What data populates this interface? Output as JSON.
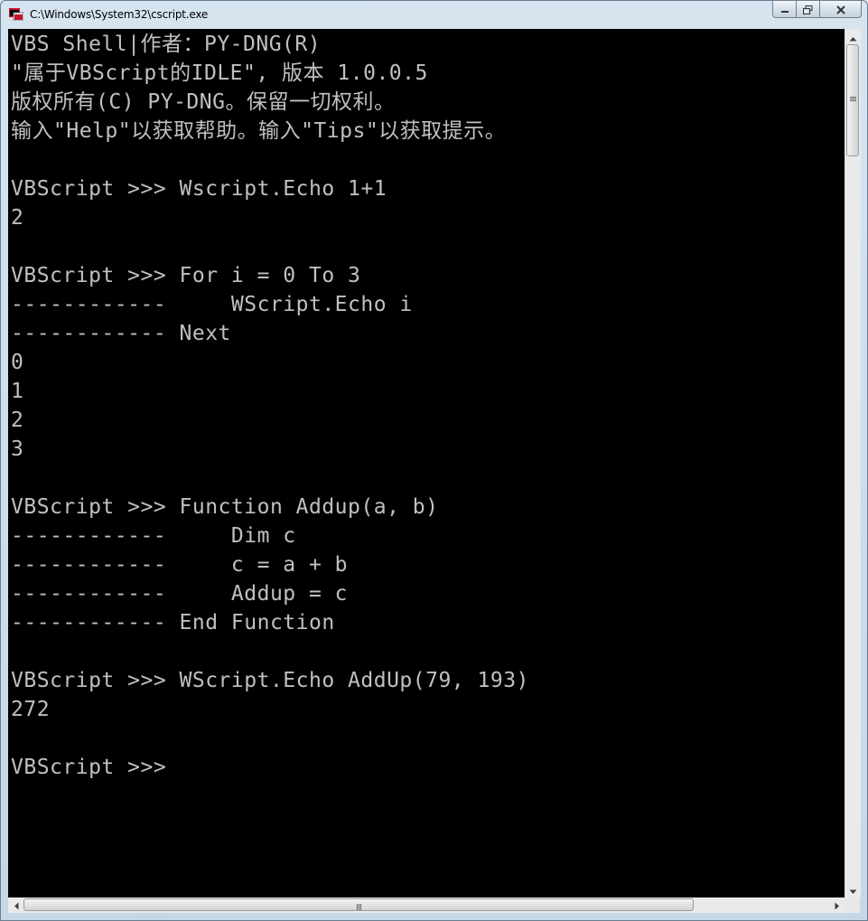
{
  "window": {
    "title": "C:\\Windows\\System32\\cscript.exe",
    "icon": "console-app-icon",
    "buttons": {
      "minimize": "minimize-icon",
      "maximize": "maximize-icon",
      "close": "close-icon"
    }
  },
  "console": {
    "background": "#000000",
    "foreground": "#c0c0c0",
    "lines": [
      "VBS Shell|作者：PY-DNG(R)",
      "\"属于VBScript的IDLE\", 版本 1.0.0.5",
      "版权所有(C) PY-DNG。保留一切权利。",
      "输入\"Help\"以获取帮助。输入\"Tips\"以获取提示。",
      "",
      "VBScript >>> Wscript.Echo 1+1",
      "2",
      "",
      "VBScript >>> For i = 0 To 3",
      "------------     WScript.Echo i",
      "------------ Next",
      "0",
      "1",
      "2",
      "3",
      "",
      "VBScript >>> Function Addup(a, b)",
      "------------     Dim c",
      "------------     c = a + b",
      "------------     Addup = c",
      "------------ End Function",
      "",
      "VBScript >>> WScript.Echo AddUp(79, 193)",
      "272",
      "",
      "VBScript >>>"
    ]
  },
  "scrollbars": {
    "vertical": {
      "up": "scroll-up-arrow-icon",
      "down": "scroll-down-arrow-icon"
    },
    "horizontal": {
      "left": "scroll-left-arrow-icon",
      "right": "scroll-right-arrow-icon"
    }
  }
}
